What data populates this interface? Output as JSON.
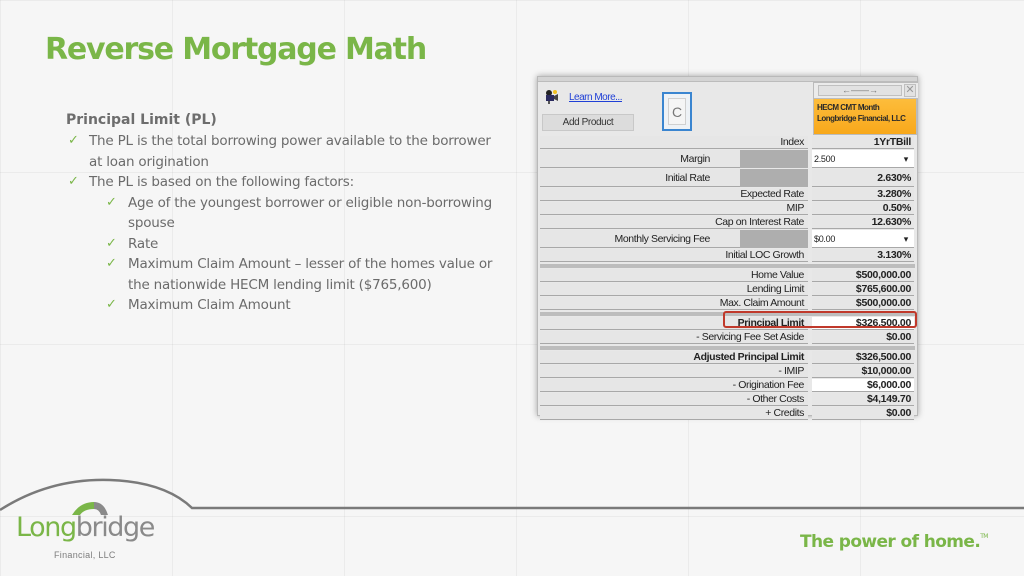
{
  "slide": {
    "title": "Reverse Mortgage Math"
  },
  "content": {
    "heading": "Principal Limit (PL)",
    "bullets": [
      {
        "level": 1,
        "text": "The PL is the total borrowing power available to the borrower at loan origination"
      },
      {
        "level": 1,
        "text": "The PL is based on the following factors:"
      },
      {
        "level": 2,
        "text": "Age of the youngest borrower or eligible non-borrowing spouse"
      },
      {
        "level": 2,
        "text": "Rate"
      },
      {
        "level": 2,
        "text": "Maximum Claim Amount – lesser of the homes value or the nationwide HECM lending limit ($765,600)"
      },
      {
        "level": 2,
        "text": "Maximum Claim Amount"
      }
    ],
    "check_glyph": "✓"
  },
  "calculator": {
    "learn_more": "Learn More...",
    "add_product": "Add Product",
    "c_button": "C",
    "product": {
      "nav_arrows": "←——→",
      "close": "✕",
      "line1": "HECM CMT Month",
      "line2": "Longbridge Financial, LLC",
      "color": "#f8a81b"
    },
    "rows": {
      "index": {
        "label": "Index",
        "value": "1YrTBill"
      },
      "margin": {
        "label": "Margin",
        "value": "2.500",
        "dropdown": "▾"
      },
      "initial_rate": {
        "label": "Initial Rate",
        "value": "2.630%"
      },
      "expected_rate": {
        "label": "Expected Rate",
        "value": "3.280%"
      },
      "mip": {
        "label": "MIP",
        "value": "0.50%"
      },
      "cap_rate": {
        "label": "Cap on Interest Rate",
        "value": "12.630%"
      },
      "servicing_fee": {
        "label": "Monthly Servicing Fee",
        "value": "$0.00",
        "dropdown": "▾"
      },
      "loc_growth": {
        "label": "Initial LOC Growth",
        "value": "3.130%"
      },
      "home_value": {
        "label": "Home Value",
        "value": "$500,000.00"
      },
      "lending_limit": {
        "label": "Lending Limit",
        "value": "$765,600.00"
      },
      "max_claim": {
        "label": "Max. Claim Amount",
        "value": "$500,000.00"
      },
      "principal_limit": {
        "label": "Principal Limit",
        "value": "$326,500.00"
      },
      "set_aside": {
        "label": "- Servicing Fee Set Aside",
        "value": "$0.00"
      },
      "adjusted_pl": {
        "label": "Adjusted Principal Limit",
        "value": "$326,500.00"
      },
      "imip": {
        "label": "- IMIP",
        "value": "$10,000.00"
      },
      "origination_fee": {
        "label": "- Origination Fee",
        "value": "$6,000.00"
      },
      "other_costs": {
        "label": "- Other Costs",
        "value": "$4,149.70"
      },
      "credits": {
        "label": "+ Credits",
        "value": "$0.00"
      }
    },
    "highlight_color": "#c0392b"
  },
  "footer": {
    "logo_part1": "Long",
    "logo_part2": "bridge",
    "logo_sub": "Financial, LLC",
    "tagline": "The power of home.",
    "tagline_tm": "TM",
    "brand_green": "#7ab648"
  }
}
